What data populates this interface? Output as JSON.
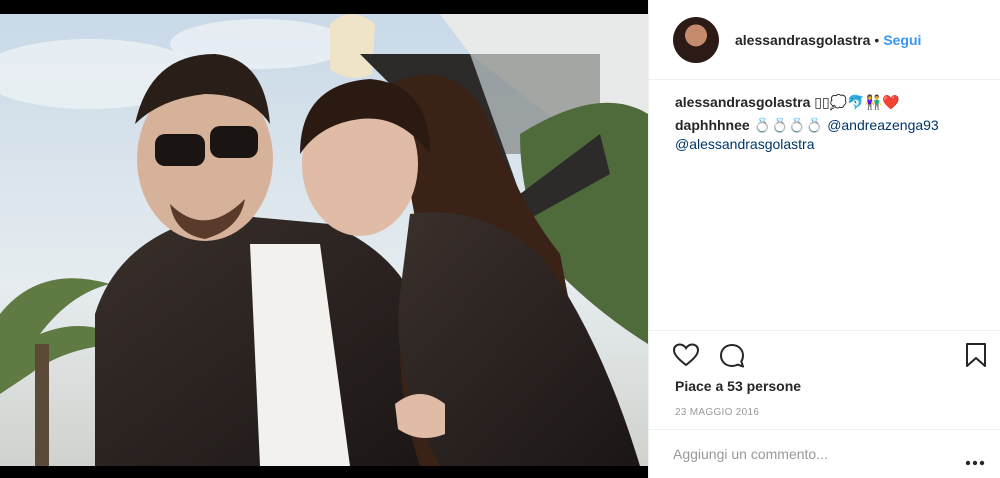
{
  "post": {
    "username": "alessandrasgolastra",
    "separator": "•",
    "follow_label": "Segui"
  },
  "comments": [
    {
      "user": "alessandrasgolastra",
      "text": " ▯▯💭🐬👫❤️"
    },
    {
      "user": "daphhhnee",
      "text": " 💍💍💍💍 ",
      "mention1": "@andreazenga93",
      "mention2": "@alessandrasgolastra"
    }
  ],
  "likes_label": "Piace a 53 persone",
  "date_label": "23 MAGGIO 2016",
  "add_comment": {
    "placeholder": "Aggiungi un commento..."
  },
  "colors": {
    "follow": "#3897f0",
    "mention": "#003569",
    "muted": "#999999",
    "divider": "#efefef"
  },
  "icons": [
    "heart-icon",
    "comment-bubble-icon",
    "bookmark-icon",
    "more-options-icon"
  ]
}
